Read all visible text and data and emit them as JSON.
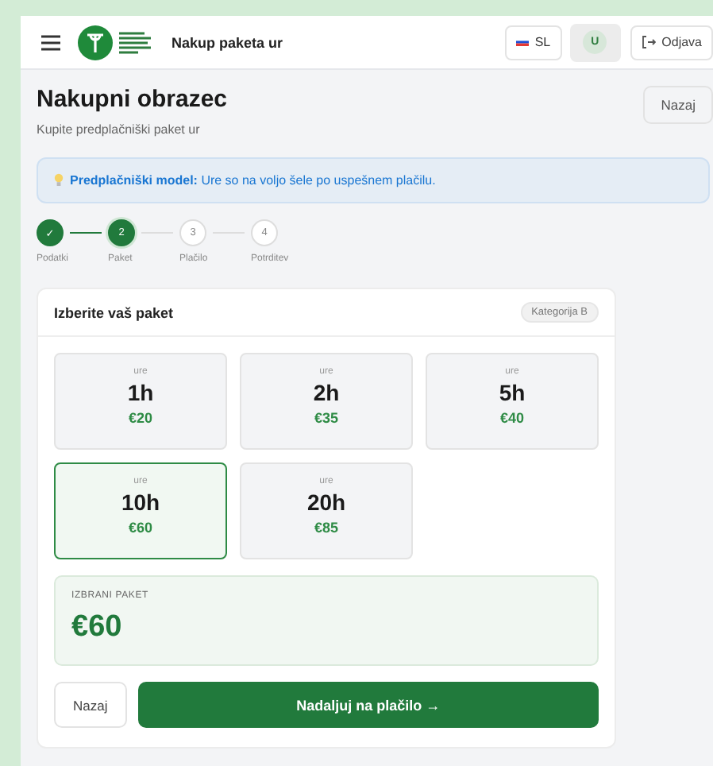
{
  "header": {
    "title": "Nakup paketa ur",
    "language": "SL",
    "avatar": "U",
    "logout": "Odjava"
  },
  "page": {
    "title": "Nakupni obrazec",
    "subtitle": "Kupite predplačniški paket ur",
    "back": "Nazaj"
  },
  "notice": "**Predplačniški model:** Ure so na voljo šele po uspešnem plačilu.",
  "steps": [
    {
      "label": "Podatki",
      "number": "✓",
      "completed": true,
      "selected": false
    },
    {
      "label": "Paket",
      "number": "2",
      "completed": false,
      "selected": true
    },
    {
      "label": "Plačilo",
      "number": "3",
      "completed": false,
      "selected": false
    },
    {
      "label": "Potrditev",
      "number": "4",
      "completed": false,
      "selected": false
    }
  ],
  "card": {
    "title": "Izberite vaš paket",
    "badge": "Kategorija B"
  },
  "packages": [
    {
      "unit": "ure",
      "hours": "1h",
      "price": "€20",
      "selected": false
    },
    {
      "unit": "ure",
      "hours": "2h",
      "price": "€35",
      "selected": false
    },
    {
      "unit": "ure",
      "hours": "5h",
      "price": "€40",
      "selected": false
    },
    {
      "unit": "ure",
      "hours": "10h",
      "price": "€60",
      "selected": true
    },
    {
      "unit": "ure",
      "hours": "20h",
      "price": "€85",
      "selected": false
    }
  ],
  "summary": {
    "label": "IZBRANI PAKET",
    "price": "€60"
  },
  "actions": {
    "back": "Nazaj",
    "next": "Nadaljuj na plačilo →"
  }
}
